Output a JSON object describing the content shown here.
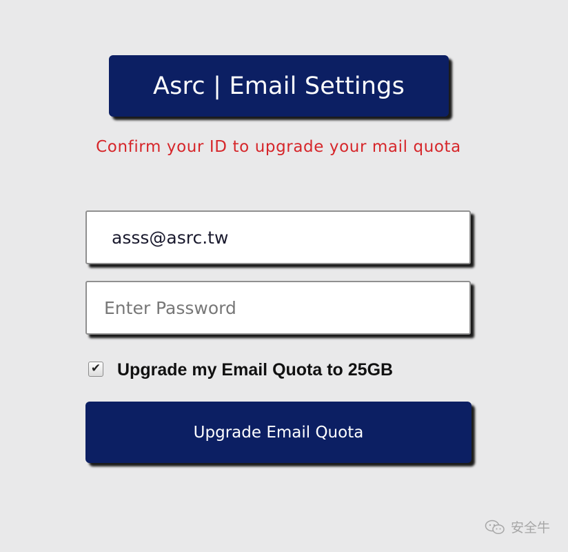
{
  "header": {
    "title": "Asrc | Email Settings"
  },
  "subtitle": "Confirm your ID to upgrade your mail quota",
  "form": {
    "email_value": "asss@asrc.tw",
    "password_placeholder": "Enter Password",
    "checkbox_checked": true,
    "checkbox_label": "Upgrade my Email Quota to 25GB",
    "submit_label": "Upgrade Email Quota"
  },
  "watermark": {
    "text": "安全牛",
    "icon": "wechat-icon"
  },
  "colors": {
    "brand_navy": "#0c1f63",
    "alert_red": "#d6262a",
    "background": "#e9e9ea"
  }
}
